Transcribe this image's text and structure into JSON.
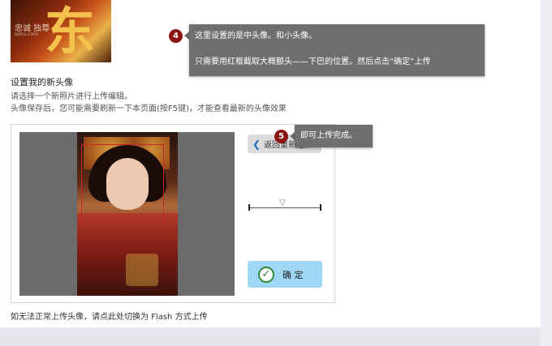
{
  "avatar_preview": {
    "glyph": "东",
    "watermark": "忠诚  独尊",
    "watermark_small": "sohu.com"
  },
  "section": {
    "title": "设置我的新头像",
    "hint_select": "请选择一个新照片进行上传编辑。",
    "hint_refresh": "头像保存后，您可能需要刷新一下本页面(按F5键)，才能查看最新的头像效果"
  },
  "editor": {
    "back_label": "返回重新选择",
    "confirm_label": "确 定",
    "confirm_icon": "check-icon",
    "back_icon": "chevron-left-icon",
    "crop_border_color": "#c62828",
    "confirm_bg": "#9fd7f5"
  },
  "footnote": "如无法正常上传头像，请点此处切换为 Flash 方式上传",
  "tips": [
    {
      "step": "4",
      "line1": "这里设置的是中头像。和小头像。",
      "line2": "只需要用红框截取大概额头——下巴的位置。然后点击“确定”上传"
    },
    {
      "step": "5",
      "line1": "即可上传完成。"
    }
  ],
  "colors": {
    "tooltip_bg": "#6f6f6f",
    "badge_bg": "#8b1414"
  }
}
